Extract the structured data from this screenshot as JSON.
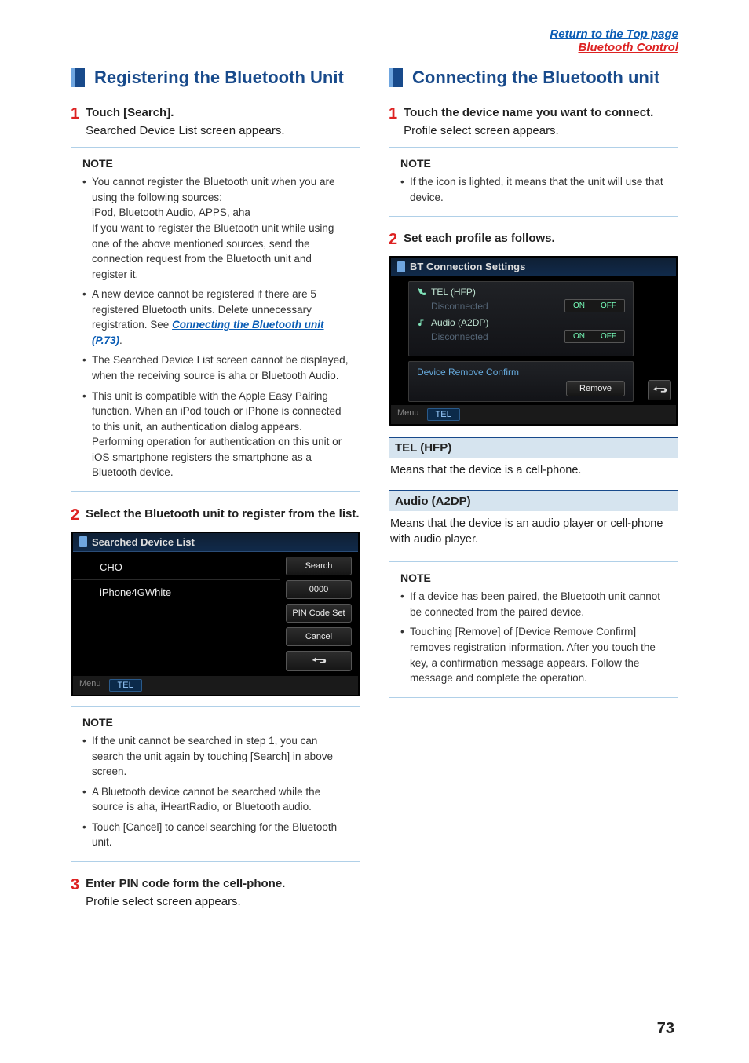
{
  "header": {
    "top_link": "Return to the Top page",
    "breadcrumb": "Bluetooth Control"
  },
  "page_number": "73",
  "left": {
    "section_title": "Registering the Bluetooth Unit",
    "step1": {
      "title": "Touch [Search].",
      "sub": "Searched Device List screen appears."
    },
    "note1": {
      "title": "NOTE",
      "items": [
        "You cannot register the Bluetooth unit when you are using the following sources:\niPod, Bluetooth Audio, APPS, aha\nIf you want to register the Bluetooth unit while using one of the above mentioned sources, send the connection request from the Bluetooth unit and register it.",
        "A new device cannot be registered if there are 5 registered Bluetooth units. Delete unnecessary registration. See ",
        "The Searched Device List screen cannot be displayed, when the receiving source is aha or Bluetooth Audio.",
        "This unit is compatible with the Apple Easy Pairing function. When an iPod touch or iPhone is connected to this unit, an authentication dialog appears. Performing operation for authentication on this unit or iOS smartphone registers the smartphone as a Bluetooth device."
      ],
      "link": "Connecting the Bluetooth unit (P.73)"
    },
    "step2": {
      "title": "Select the Bluetooth unit to register from the list."
    },
    "ui1": {
      "bar": "Searched Device List",
      "items": [
        "CHO",
        "iPhone4GWhite"
      ],
      "side": [
        "Search",
        "0000",
        "PIN Code Set",
        "Cancel"
      ],
      "menu": "Menu",
      "tab": "TEL"
    },
    "note2": {
      "title": "NOTE",
      "items": [
        "If the unit cannot be searched in step 1, you can search the unit again by touching [Search] in above screen.",
        "A Bluetooth device cannot be searched while the source is aha, iHeartRadio, or Bluetooth audio.",
        "Touch [Cancel] to cancel searching for the Bluetooth unit."
      ]
    },
    "step3": {
      "title": "Enter PIN code form the cell-phone.",
      "sub": "Profile select screen appears."
    }
  },
  "right": {
    "section_title": "Connecting the Bluetooth unit",
    "step1": {
      "title": "Touch the device name you want to connect.",
      "sub": "Profile select screen appears."
    },
    "note1": {
      "title": "NOTE",
      "items": [
        "If the icon is lighted, it means that the unit will use that device."
      ]
    },
    "step2": {
      "title": "Set each profile as follows."
    },
    "ui2": {
      "bar": "BT Connection Settings",
      "tel_label": "TEL (HFP)",
      "audio_label": "Audio (A2DP)",
      "disc": "Disconnected",
      "on": "ON",
      "off": "OFF",
      "remove_label": "Device Remove Confirm",
      "remove_btn": "Remove",
      "menu": "Menu",
      "tab": "TEL"
    },
    "tel_hdr": "TEL (HFP)",
    "tel_desc": "Means that the device is a cell-phone.",
    "audio_hdr": "Audio (A2DP)",
    "audio_desc": "Means that the device is an audio player or cell-phone with audio player.",
    "note2": {
      "title": "NOTE",
      "items": [
        "If a device has been paired, the Bluetooth unit cannot be connected from the paired device.",
        "Touching [Remove] of [Device Remove Confirm] removes registration information. After you touch the key, a confirmation message appears. Follow the message and complete the operation."
      ]
    }
  }
}
